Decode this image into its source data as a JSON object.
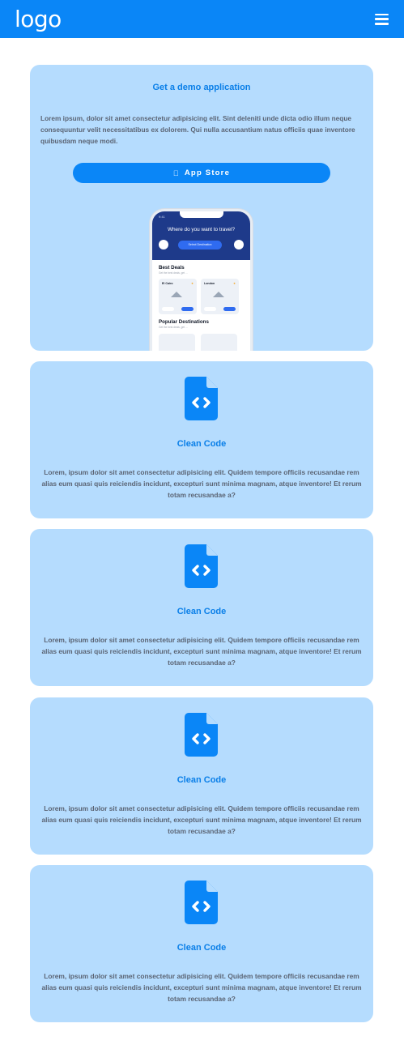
{
  "header": {
    "logo": "logo"
  },
  "demo": {
    "title": "Get a demo application",
    "text": "Lorem ipsum, dolor sit amet consectetur adipisicing elit. Sint deleniti unde dicta odio illum neque consequuntur velit necessitatibus ex dolorem. Qui nulla accusantium natus officiis quae inventore quibusdam neque modi.",
    "button_label": "App Store",
    "phone": {
      "time": "9:41",
      "question": "Where do you want to travel?",
      "select_label": "Select Destination",
      "section1": "Best Deals",
      "section1_sub": "Get the best deals, get ...",
      "deal1_city": "El Cairo",
      "deal2_city": "London",
      "section2": "Popular Destinations",
      "section2_sub": "Get the best deals, get ..."
    }
  },
  "features": [
    {
      "title": "Clean Code",
      "text": "Lorem, ipsum dolor sit amet consectetur adipisicing elit. Quidem tempore officiis recusandae rem alias eum quasi quis reiciendis incidunt, excepturi sunt minima magnam, atque inventore! Et rerum totam recusandae a?"
    },
    {
      "title": "Clean Code",
      "text": "Lorem, ipsum dolor sit amet consectetur adipisicing elit. Quidem tempore officiis recusandae rem alias eum quasi quis reiciendis incidunt, excepturi sunt minima magnam, atque inventore! Et rerum totam recusandae a?"
    },
    {
      "title": "Clean Code",
      "text": "Lorem, ipsum dolor sit amet consectetur adipisicing elit. Quidem tempore officiis recusandae rem alias eum quasi quis reiciendis incidunt, excepturi sunt minima magnam, atque inventore! Et rerum totam recusandae a?"
    },
    {
      "title": "Clean Code",
      "text": "Lorem, ipsum dolor sit amet consectetur adipisicing elit. Quidem tempore officiis recusandae rem alias eum quasi quis reiciendis incidunt, excepturi sunt minima magnam, atque inventore! Et rerum totam recusandae a?"
    }
  ],
  "colors": {
    "primary": "#0a86f7",
    "card_background": "#b5dcfe",
    "heading": "#0a7fe8"
  }
}
